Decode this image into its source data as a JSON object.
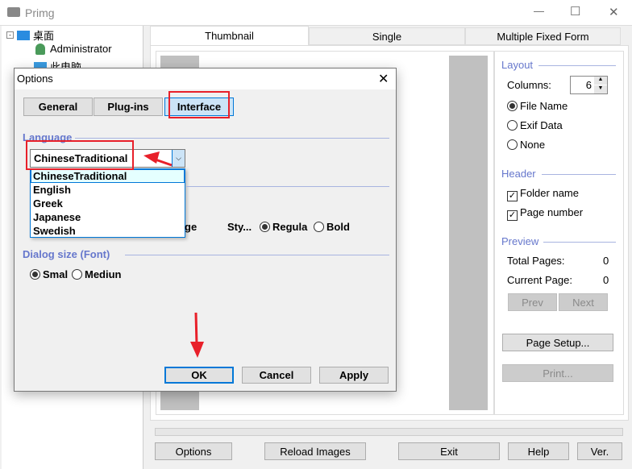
{
  "window": {
    "title": "Primg",
    "controls": {
      "minimize": "—",
      "maximize": "☐",
      "close": "✕"
    }
  },
  "tree": {
    "items": [
      {
        "label": "桌面",
        "icon": "desktop-icon"
      },
      {
        "label": "Administrator",
        "icon": "user-icon"
      },
      {
        "label": "此电脑",
        "icon": "computer-icon"
      }
    ]
  },
  "tabs": [
    {
      "label": "Thumbnail",
      "active": true
    },
    {
      "label": "Single"
    },
    {
      "label": "Multiple Fixed Form"
    }
  ],
  "side": {
    "layout_title": "Layout",
    "columns_label": "Columns:",
    "columns_value": "6",
    "radios": [
      {
        "label": "File Name",
        "checked": true
      },
      {
        "label": "Exif Data"
      },
      {
        "label": "None"
      }
    ],
    "header_title": "Header",
    "checks": [
      {
        "label": "Folder name",
        "checked": true
      },
      {
        "label": "Page number",
        "checked": true
      }
    ],
    "preview_title": "Preview",
    "total_label": "Total Pages:",
    "total_value": "0",
    "current_label": "Current Page:",
    "current_value": "0",
    "prev": "Prev",
    "next": "Next",
    "page_setup": "Page Setup...",
    "print": "Print..."
  },
  "bottom": {
    "options": "Options",
    "reload": "Reload Images",
    "exit": "Exit",
    "help": "Help",
    "ver": "Ver."
  },
  "dialog": {
    "title": "Options",
    "close": "✕",
    "tabs": [
      "General",
      "Plug-ins",
      "Interface"
    ],
    "language_title": "Language",
    "language_value": "ChineseTraditional",
    "language_options": [
      "ChineseTraditional",
      "English",
      "Greek",
      "Japanese",
      "Swedish"
    ],
    "font_title": "Fo",
    "size_partial": "ge",
    "style_label": "Sty...",
    "style_regular": "Regula",
    "style_bold": "Bold",
    "dialog_size_title": "Dialog size (Font)",
    "size_small": "Smal",
    "size_medium": "Mediun",
    "ok": "OK",
    "cancel": "Cancel",
    "apply": "Apply"
  },
  "colors": {
    "annotation": "#e8202a",
    "accent": "#0078d7",
    "group_title": "#6677cc"
  }
}
